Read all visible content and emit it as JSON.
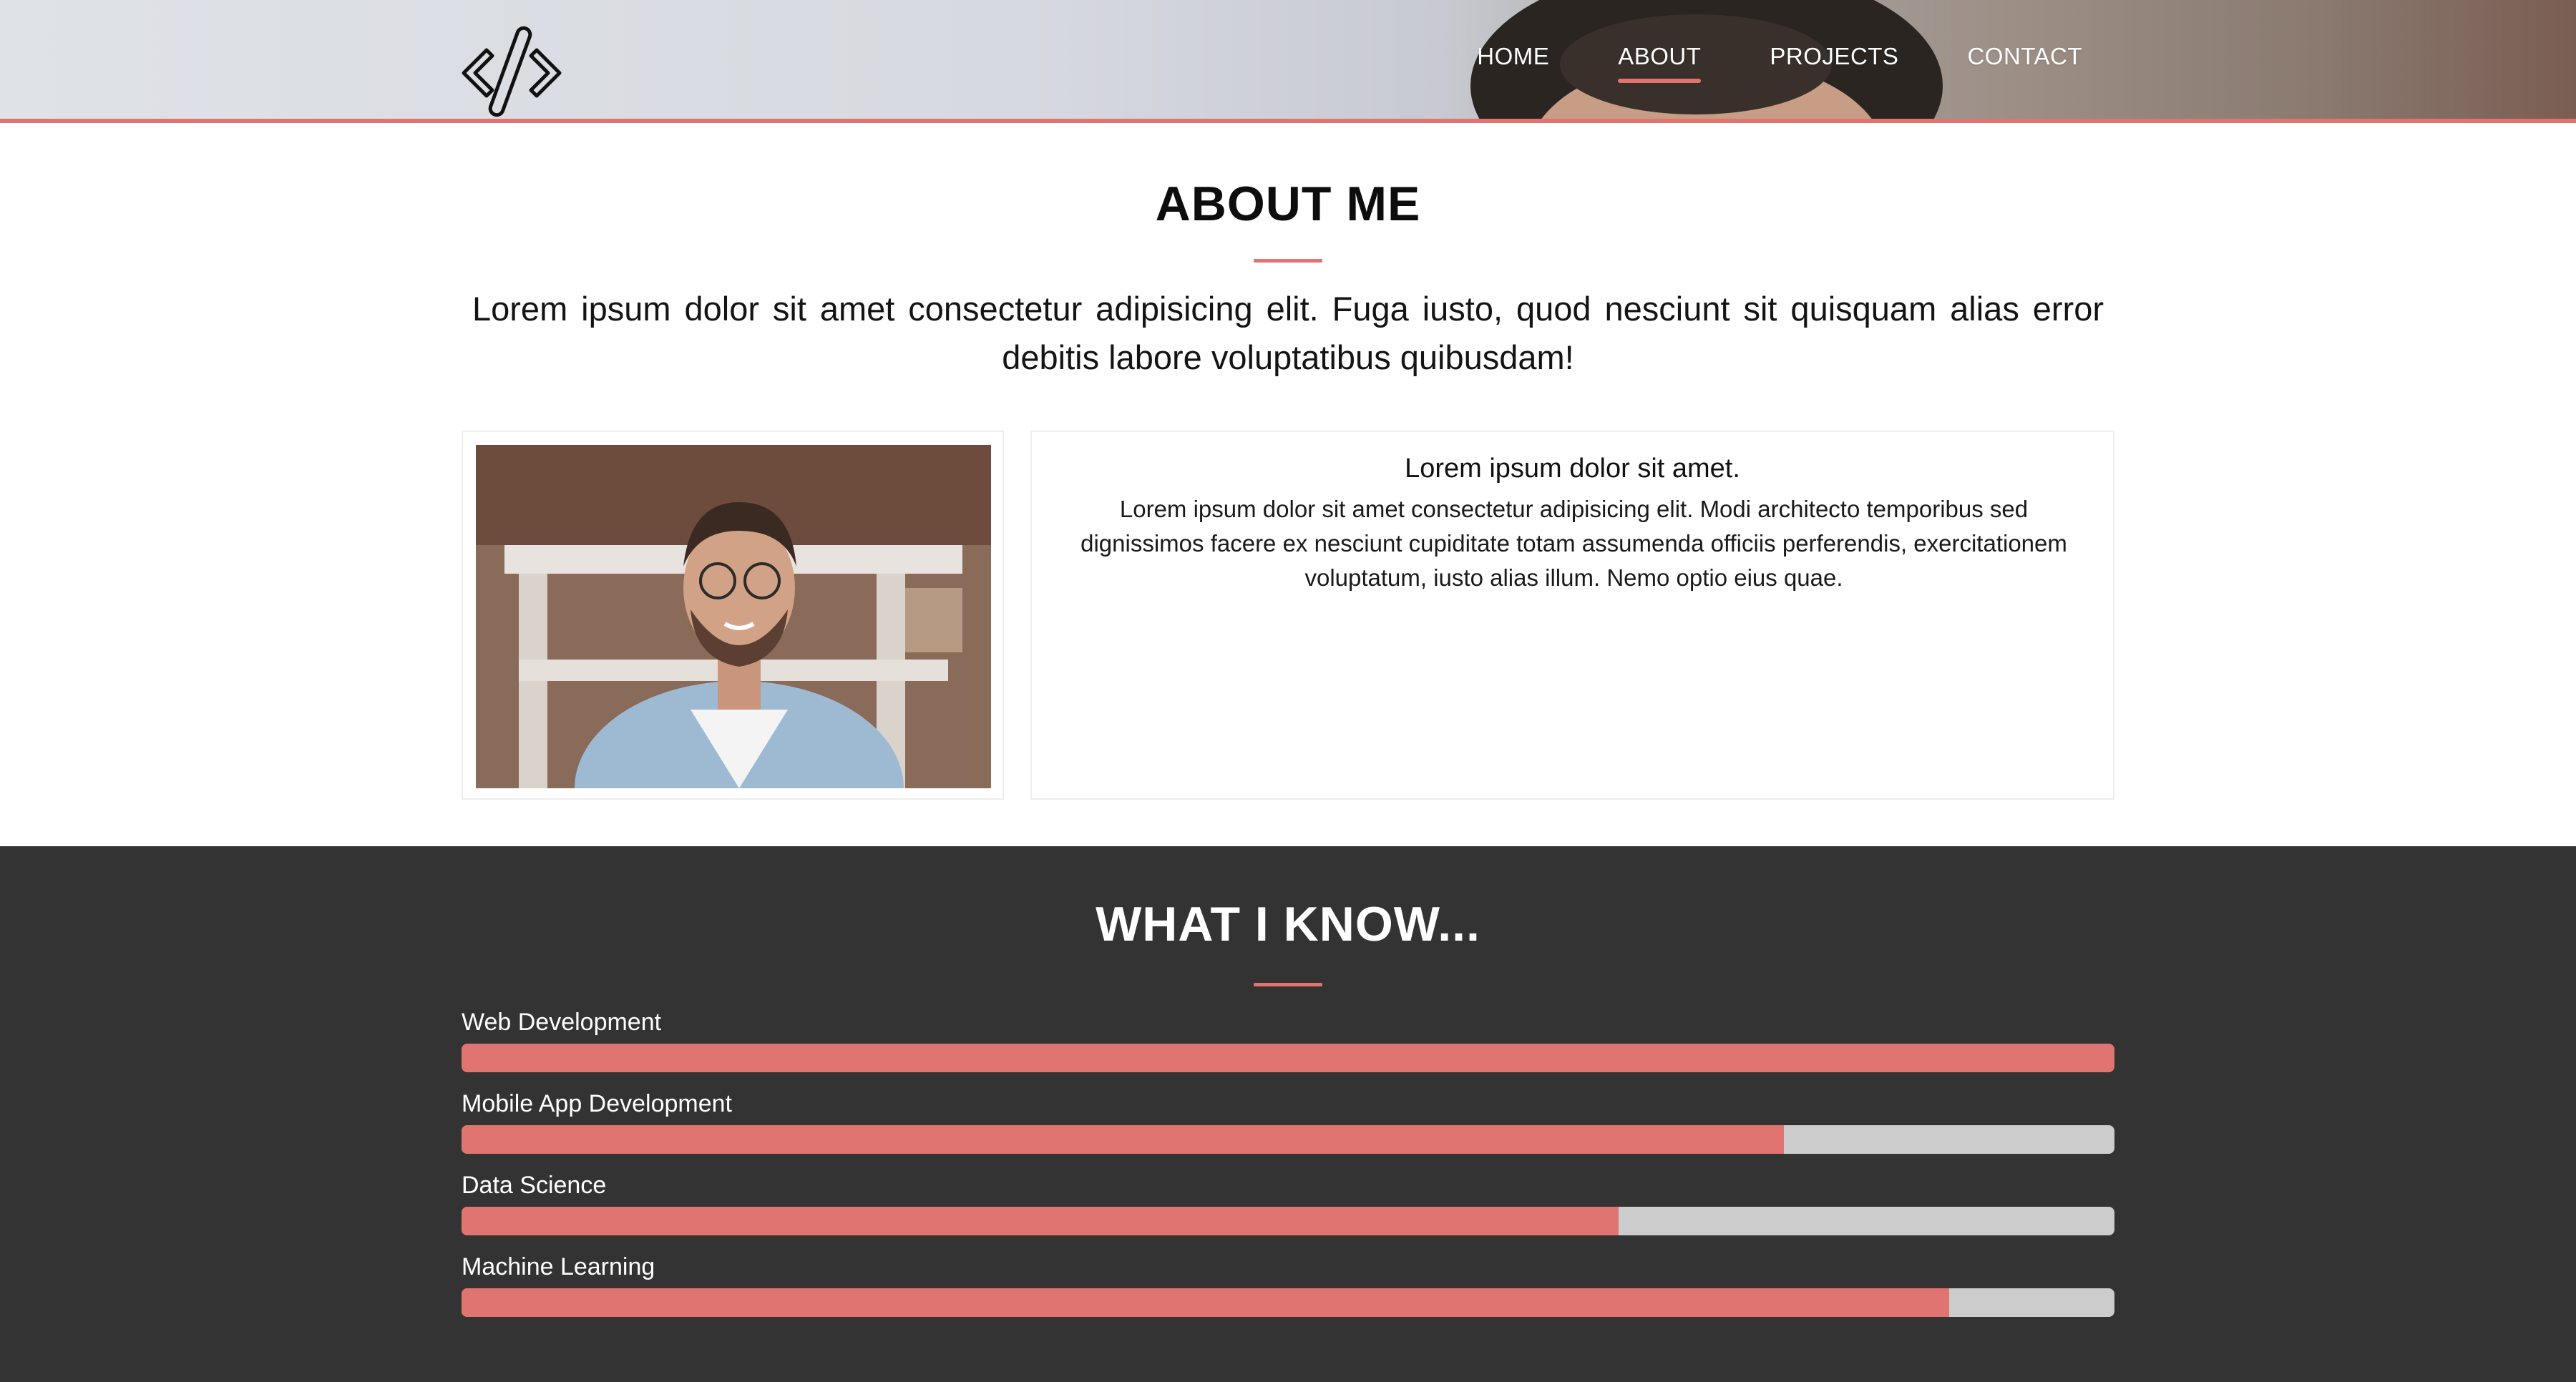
{
  "logo": {
    "icon": "code-brackets-icon"
  },
  "nav": {
    "items": [
      {
        "label": "HOME",
        "active": false
      },
      {
        "label": "ABOUT",
        "active": true
      },
      {
        "label": "PROJECTS",
        "active": false
      },
      {
        "label": "CONTACT",
        "active": false
      }
    ]
  },
  "about": {
    "title": "ABOUT ME",
    "intro": "Lorem ipsum dolor sit amet consectetur adipisicing elit. Fuga iusto, quod nesciunt sit quisquam alias error debitis labore voluptatibus quibusdam!",
    "card": {
      "title": "Lorem ipsum dolor sit amet.",
      "body": "Lorem ipsum dolor sit amet consectetur adipisicing elit. Modi architecto temporibus sed dignissimos facere ex nesciunt cupiditate totam assumenda officiis perferendis, exercitationem voluptatum, iusto alias illum. Nemo optio eius quae."
    }
  },
  "skills": {
    "title": "WHAT I KNOW...",
    "items": [
      {
        "label": "Web Development",
        "level": 1.0
      },
      {
        "label": "Mobile App Development",
        "level": 0.8
      },
      {
        "label": "Data Science",
        "level": 0.7
      },
      {
        "label": "Machine Learning",
        "level": 0.9
      }
    ]
  },
  "colors": {
    "accent": "#e07470",
    "dark_section": "#333333",
    "track": "#cccccc"
  }
}
